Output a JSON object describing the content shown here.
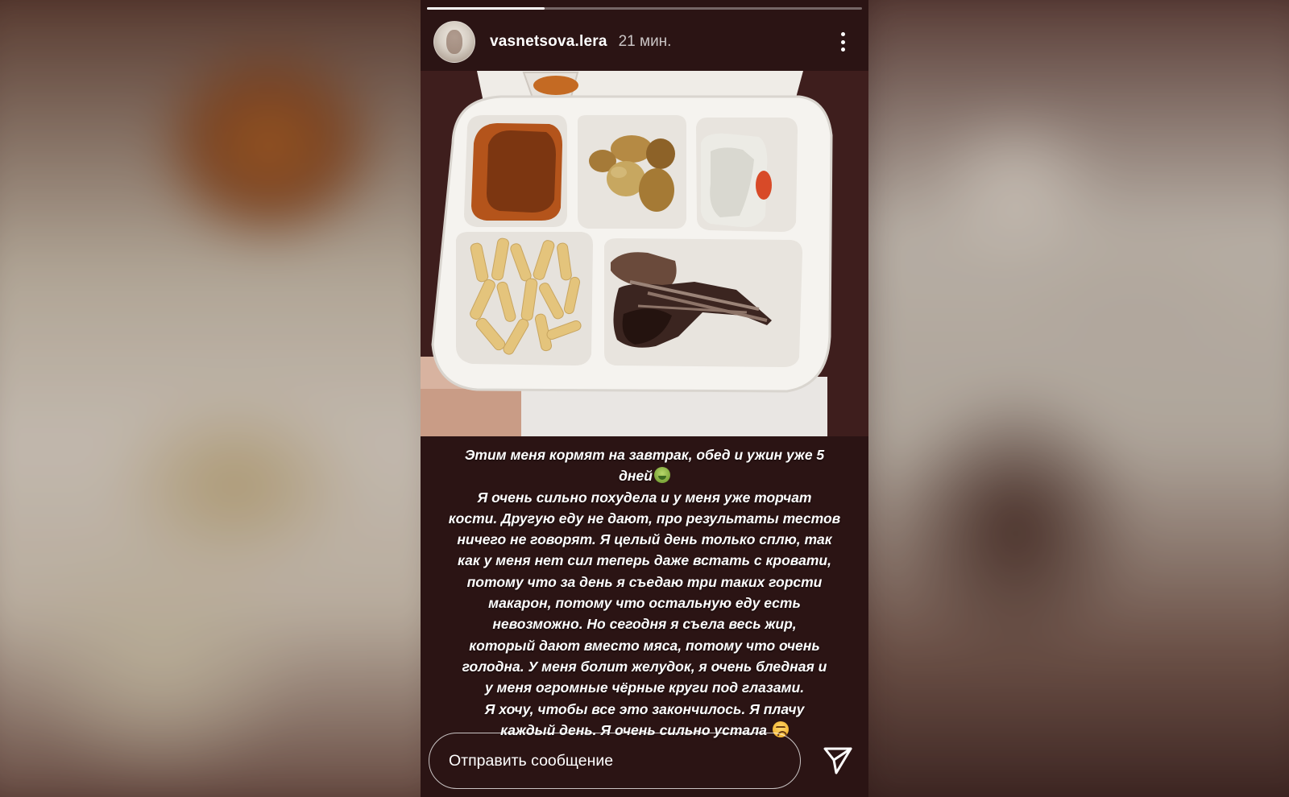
{
  "story": {
    "progress": 0.27,
    "username": "vasnetsova.lera",
    "time_ago": "21 мин.",
    "more_icon": "more-vertical-icon",
    "photo_subject": "food-tray-photo",
    "caption_lines": [
      "Этим меня кормят на завтрак, обед и ужин уже 5",
      "дней",
      "Я очень сильно похудела и у меня уже торчат",
      "кости. Другую еду не дают, про результаты тестов",
      "ничего не говорят. Я целый день только сплю, так",
      "как у меня нет сил теперь даже встать с кровати,",
      "потому что за день я съедаю три таких горсти",
      "макарон, потому что остальную еду есть",
      "невозможно. Но сегодня я съела весь жир,",
      "который дают вместо мяса, потому что очень",
      "голодна. У меня болит желудок, я очень бледная и",
      "у меня огромные чёрные круги под глазами.",
      "Я хочу, чтобы все это закончилось. Я плачу",
      "каждый день. Я очень сильно устала"
    ],
    "emoji_after_line_2": "nauseated-face-emoji",
    "emoji_after_line_14": "weary-face-emoji",
    "reply_placeholder": "Отправить сообщение",
    "send_icon": "send-icon"
  },
  "colors": {
    "story_bg": "#2b1414",
    "text": "#ffffff"
  }
}
